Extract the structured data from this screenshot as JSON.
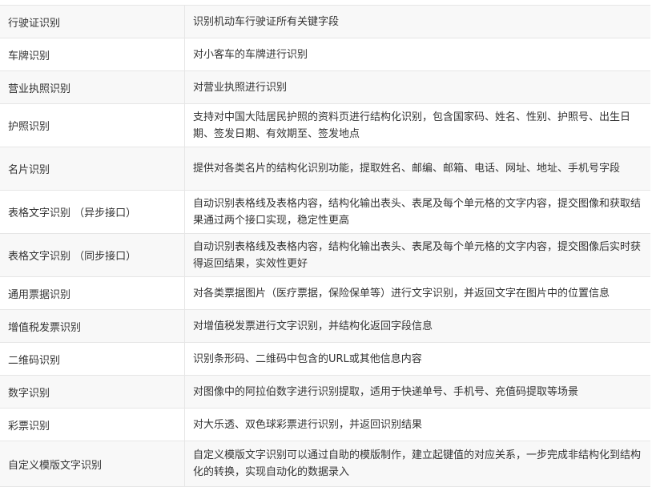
{
  "rows": [
    {
      "name": "行驶证识别",
      "desc": "识别机动车行驶证所有关键字段"
    },
    {
      "name": "车牌识别",
      "desc": "对小客车的车牌进行识别"
    },
    {
      "name": "营业执照识别",
      "desc": "对营业执照进行识别"
    },
    {
      "name": "护照识别",
      "desc": "支持对中国大陆居民护照的资料页进行结构化识别，包含国家码、姓名、性别、护照号、出生日期、签发日期、有效期至、签发地点"
    },
    {
      "name": "名片识别",
      "desc": "提供对各类名片的结构化识别功能，提取姓名、邮编、邮箱、电话、网址、地址、手机号字段"
    },
    {
      "name": "表格文字识别 （异步接口）",
      "desc": "自动识别表格线及表格内容，结构化输出表头、表尾及每个单元格的文字内容，提交图像和获取结果通过两个接口实现，稳定性更高"
    },
    {
      "name": "表格文字识别 （同步接口）",
      "desc": "自动识别表格线及表格内容，结构化输出表头、表尾及每个单元格的文字内容，提交图像后实时获得返回结果，实效性更好"
    },
    {
      "name": "通用票据识别",
      "desc": "对各类票据图片（医疗票据，保险保单等）进行文字识别，并返回文字在图片中的位置信息"
    },
    {
      "name": "增值税发票识别",
      "desc": "对增值税发票进行文字识别，并结构化返回字段信息"
    },
    {
      "name": "二维码识别",
      "desc": "识别条形码、二维码中包含的URL或其他信息内容"
    },
    {
      "name": "数字识别",
      "desc": "对图像中的阿拉伯数字进行识别提取，适用于快递单号、手机号、充值码提取等场景"
    },
    {
      "name": "彩票识别",
      "desc": "对大乐透、双色球彩票进行识别，并返回识别结果"
    },
    {
      "name": "自定义模版文字识别",
      "desc": "自定义模版文字识别可以通过自助的模版制作，建立起键值的对应关系，一步完成非结构化到结构化的转换，实现自动化的数据录入"
    }
  ]
}
